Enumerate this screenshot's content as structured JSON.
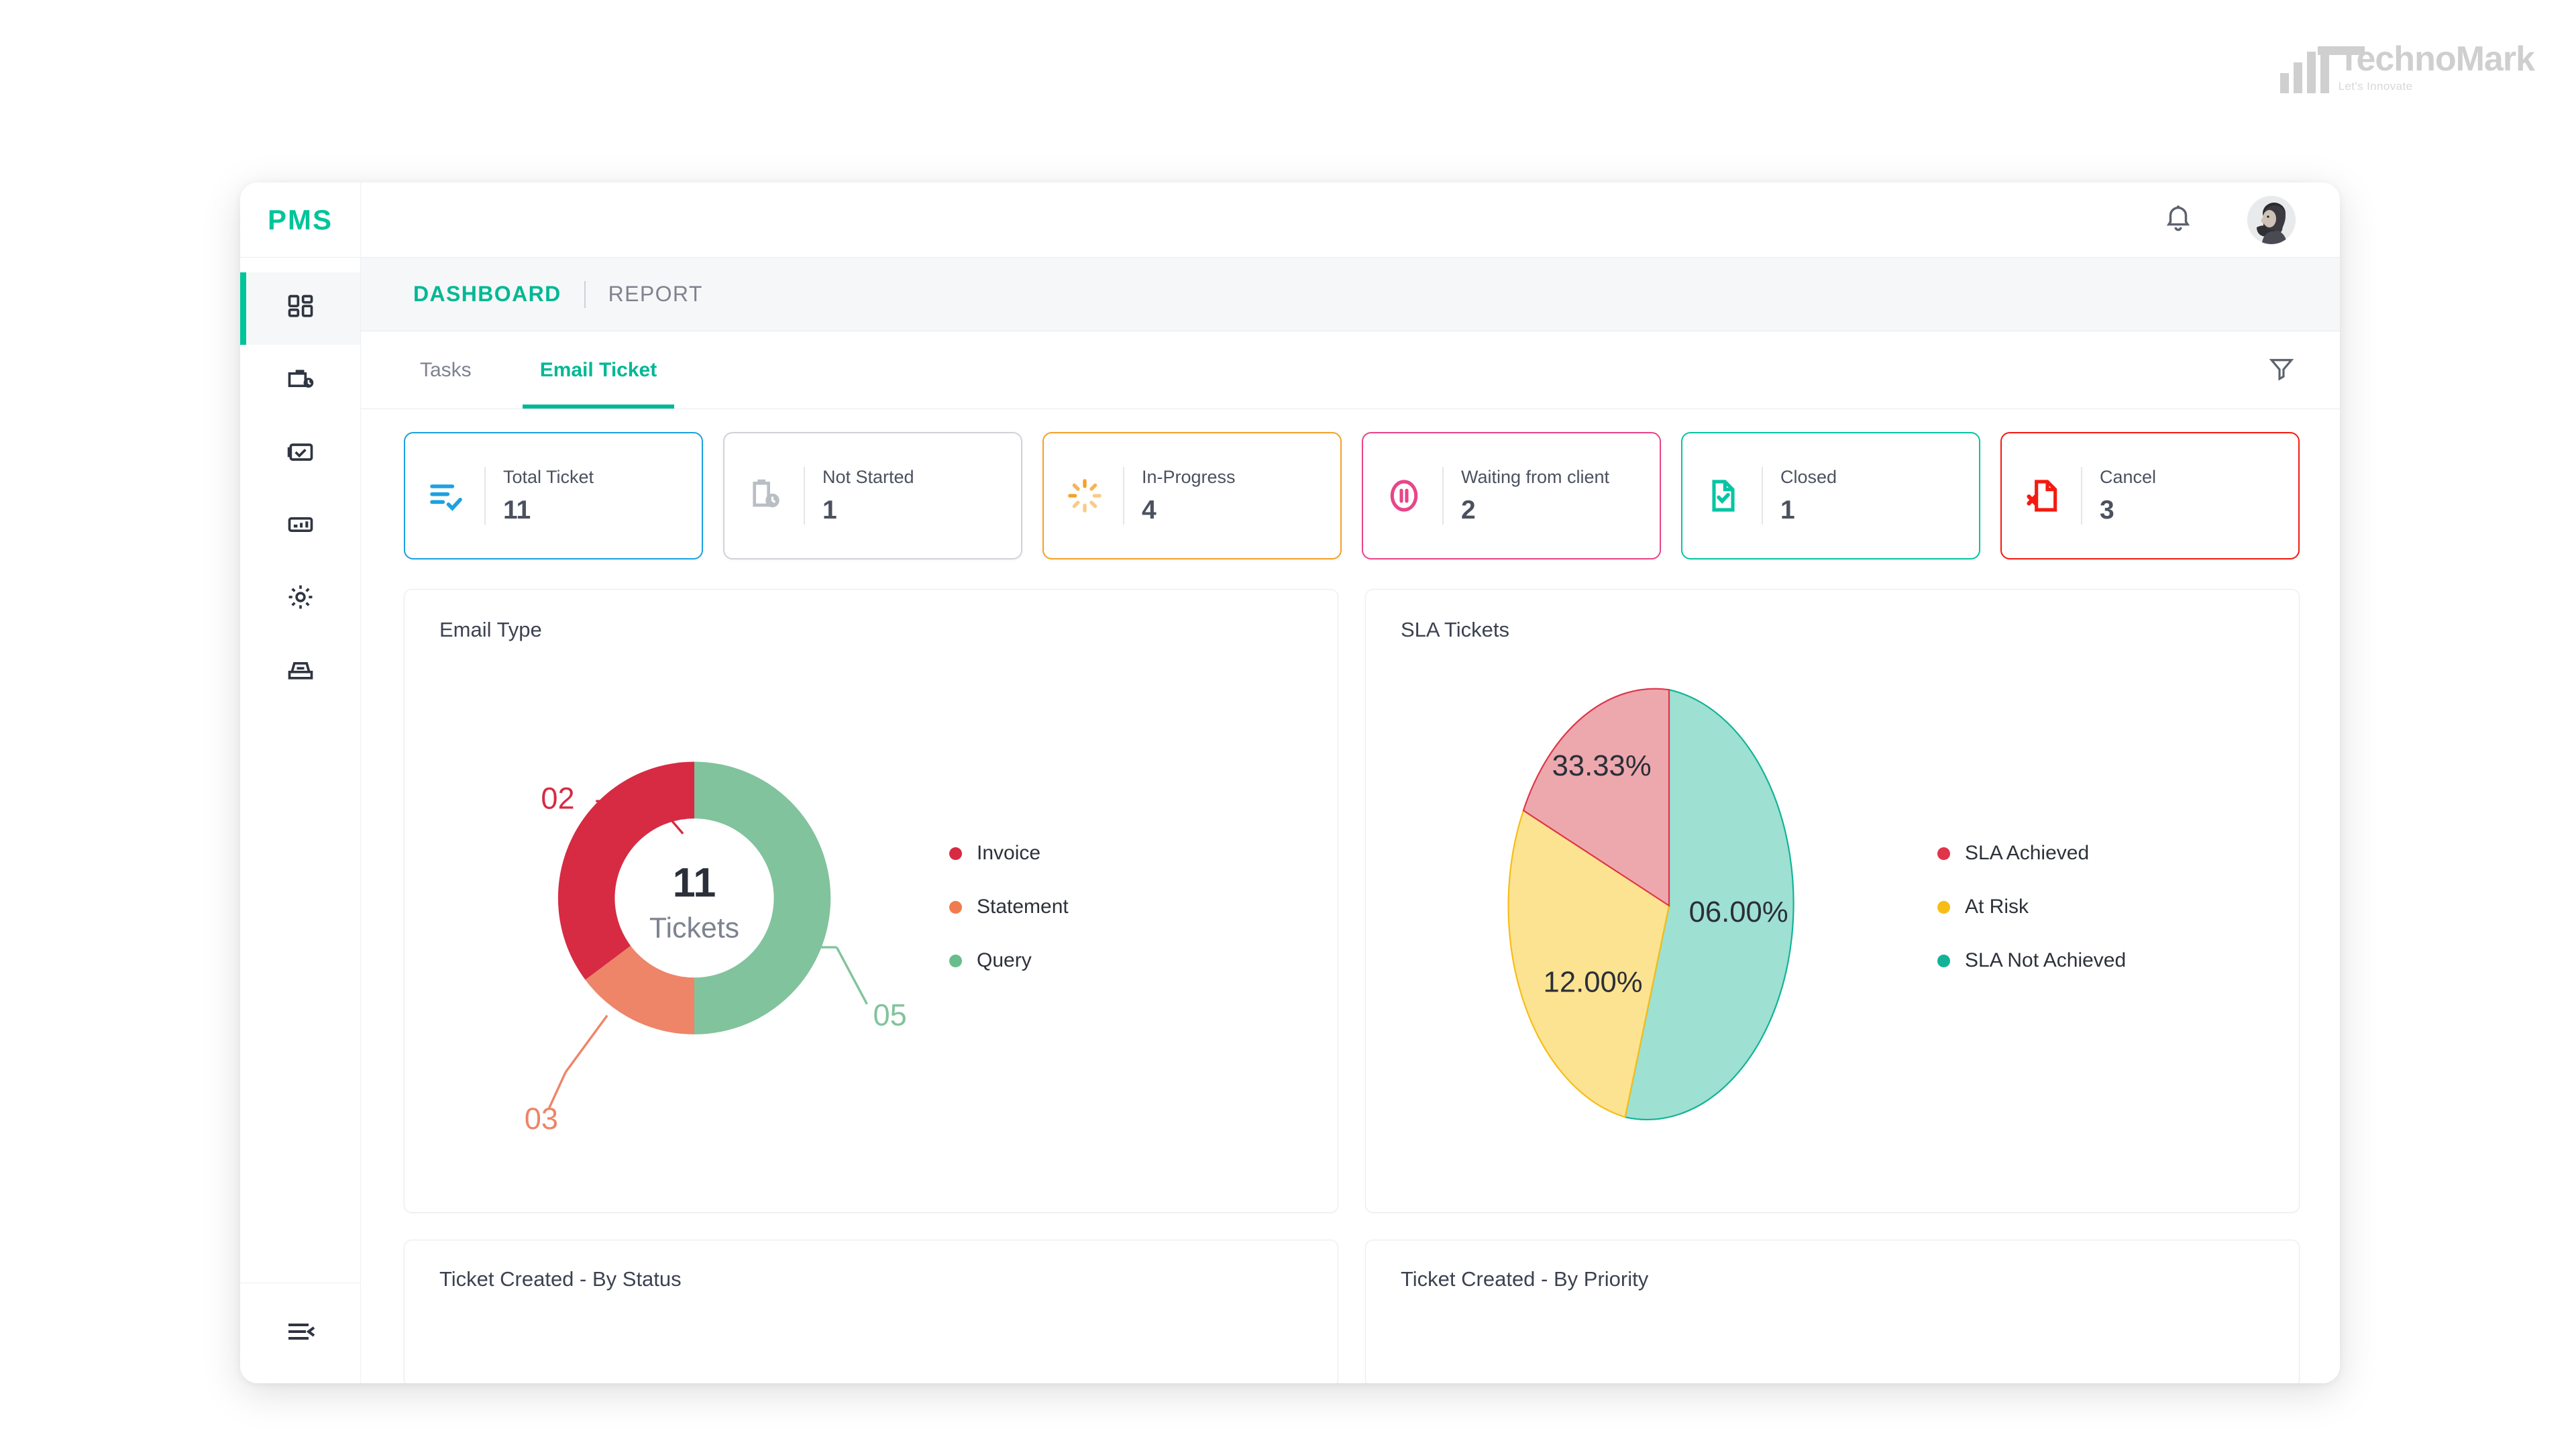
{
  "brand": {
    "name": "TechnoMark",
    "tagline": "Let's Innovate"
  },
  "sidebar": {
    "logo": "PMS",
    "items": [
      {
        "icon": "dashboard-grid-icon",
        "name": "dashboard"
      },
      {
        "icon": "briefcase-clock-icon",
        "name": "projects"
      },
      {
        "icon": "clipboard-check-icon",
        "name": "tasks"
      },
      {
        "icon": "bar-chart-icon",
        "name": "reports"
      },
      {
        "icon": "gear-icon",
        "name": "settings"
      },
      {
        "icon": "inbox-tray-icon",
        "name": "inbox"
      }
    ],
    "collapse_icon": "collapse-menu-icon"
  },
  "topbar": {
    "bell_icon": "bell-icon",
    "avatar": "user-avatar"
  },
  "breadcrumb": {
    "active": "DASHBOARD",
    "inactive": "REPORT"
  },
  "tabs": [
    {
      "label": "Tasks",
      "active": false
    },
    {
      "label": "Email Ticket",
      "active": true
    }
  ],
  "filter": {
    "icon": "funnel-filter-icon"
  },
  "stats": [
    {
      "label": "Total Ticket",
      "value": "11",
      "color": "#1da1e0",
      "icon": "list-check-icon"
    },
    {
      "label": "Not Started",
      "value": "1",
      "color": "#b9bec5",
      "icon": "clipboard-clock-icon"
    },
    {
      "label": "In-Progress",
      "value": "4",
      "color": "#f5a12a",
      "icon": "spinner-icon"
    },
    {
      "label": "Waiting from client",
      "value": "2",
      "color": "#e8458a",
      "icon": "pause-circle-icon"
    },
    {
      "label": "Closed",
      "value": "1",
      "color": "#08c4a4",
      "icon": "file-check-icon"
    },
    {
      "label": "Cancel",
      "value": "3",
      "color": "#f51a0f",
      "icon": "file-x-icon"
    }
  ],
  "chart_data": [
    {
      "type": "pie",
      "variant": "donut",
      "title": "Email Type",
      "center_value": "11",
      "center_label": "Tickets",
      "categories": [
        "Invoice",
        "Statement",
        "Query"
      ],
      "values": [
        2,
        3,
        5
      ],
      "data_labels": [
        "02",
        "03",
        "05"
      ],
      "colors": [
        "#d62b43",
        "#ee8468",
        "#81c39c"
      ],
      "legend_colors": [
        "#d62b43",
        "#ef7b4f",
        "#68bd8d"
      ],
      "legend_position": "right",
      "grid": false
    },
    {
      "type": "pie",
      "variant": "pie",
      "title": "SLA Tickets",
      "categories": [
        "SLA Achieved",
        "At Risk",
        "SLA Not Achieved"
      ],
      "values": [
        33.33,
        12.0,
        6.0
      ],
      "data_labels": [
        "33.33%",
        "12.00%",
        "06.00%"
      ],
      "slice_fractions": [
        0.196,
        0.3,
        0.504
      ],
      "colors": [
        "#eda8ad",
        "#fce392",
        "#9ee0d2"
      ],
      "stroke_colors": [
        "#e03449",
        "#f7bd16",
        "#11b396"
      ],
      "legend_colors": [
        "#e03449",
        "#f7bd16",
        "#11b396"
      ],
      "legend_position": "right",
      "grid": false
    }
  ],
  "bottom_cards": [
    {
      "title": "Ticket Created - By Status"
    },
    {
      "title": "Ticket Created - By Priority"
    }
  ]
}
